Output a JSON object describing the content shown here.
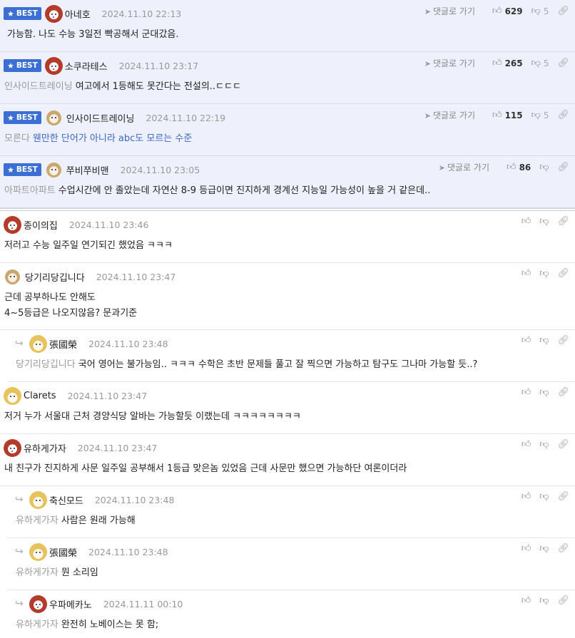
{
  "best_label": "BEST",
  "goto_label": "댓글로 가기",
  "best_comments": [
    {
      "nick": "아네호",
      "time": "2024.11.10 22:13",
      "mention": "",
      "text": "가능함. 나도 수능 3일전 빡공해서 군대갔음.",
      "up": "629",
      "down": "5",
      "avatar": "red"
    },
    {
      "nick": "소쿠라테스",
      "time": "2024.11.10 23:17",
      "mention": "인사이드트레이닝",
      "text": "여고에서 1등해도 못간다는 전설의..ㄷㄷㄷ",
      "up": "265",
      "down": "5",
      "avatar": "red"
    },
    {
      "nick": "인사이드트레이닝",
      "time": "2024.11.10 22:19",
      "mention": "모른다",
      "text": "웬만한 단어가 아니라 abc도 모르는 수준",
      "up": "115",
      "down": "5",
      "avatar": "tan"
    },
    {
      "nick": "쭈비쭈비맨",
      "time": "2024.11.10 23:05",
      "mention": "아파트아파트",
      "text": "수업시간에 안 졸았는데 자연산 8-9 등급이면 진지하게 경계선 지능일 가능성이 높을 거 같은데..",
      "up": "86",
      "down": "",
      "avatar": "tan"
    }
  ],
  "comments": [
    {
      "nick": "종이의집",
      "time": "2024.11.10 23:46",
      "mention": "",
      "lines": [
        "저러고 수능 일주일 연기되긴 했었음 ㅋㅋㅋ"
      ],
      "avatar": "red"
    },
    {
      "nick": "당기리당깁니다",
      "time": "2024.11.10 23:47",
      "mention": "",
      "lines": [
        "근데 공부하나도 안해도",
        "4~5등급은 나오지않음? 문과기준"
      ],
      "avatar": "tan"
    },
    {
      "nick": "張國榮",
      "time": "2024.11.10 23:48",
      "mention": "당기리당깁니다",
      "lines": [
        "국어 영어는 불가능임.. ㅋㅋㅋ 수학은 초반 문제들 풀고 잘 찍으면 가능하고 탐구도 그나마 가능할 듯..?"
      ],
      "avatar": "fox",
      "reply": true
    },
    {
      "nick": "Clarets",
      "time": "2024.11.10 23:47",
      "mention": "",
      "lines": [
        "저거 누가 서울대 근처 경양식당 알바는 가능할듯 이랬는데 ㅋㅋㅋㅋㅋㅋㅋㅋ"
      ],
      "avatar": "fox"
    },
    {
      "nick": "유하게가자",
      "time": "2024.11.10 23:47",
      "mention": "",
      "lines": [
        "내 친구가 진지하게 사문 일주일 공부해서 1등급 맞은놈 있었음 근데 사문만 했으면 가능하단 여론이더라"
      ],
      "avatar": "red"
    },
    {
      "nick": "축신모드",
      "time": "2024.11.10 23:48",
      "mention": "유하게가자",
      "lines": [
        "사람은 원래 가능해"
      ],
      "avatar": "fox",
      "reply": true
    },
    {
      "nick": "張國榮",
      "time": "2024.11.10 23:48",
      "mention": "유하게가자",
      "lines": [
        "뭔 소리임"
      ],
      "avatar": "fox",
      "reply": true
    },
    {
      "nick": "우파메카노",
      "time": "2024.11.11 00:10",
      "mention": "유하게가자",
      "lines": [
        "완전히 노베이스는 못 함;"
      ],
      "avatar": "red",
      "reply": true
    }
  ]
}
